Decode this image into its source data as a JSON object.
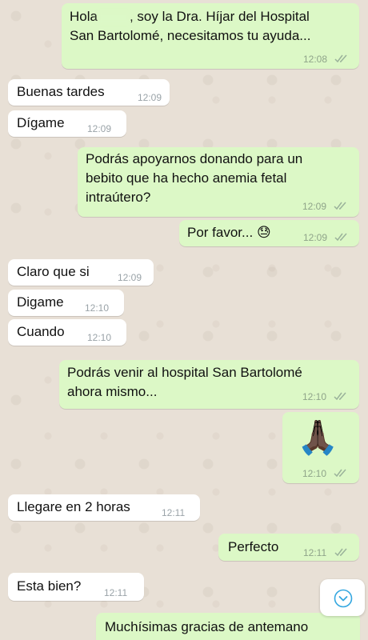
{
  "messages": [
    {
      "direction": "out",
      "text_parts": [
        "Hola",
        ", soy la Dra. Híjar del Hospital",
        "San Bartolomé, necesitamos tu ayuda..."
      ],
      "time": "12:08"
    },
    {
      "direction": "in",
      "text": "Buenas tardes",
      "time": "12:09"
    },
    {
      "direction": "in",
      "text": "Dígame",
      "time": "12:09"
    },
    {
      "direction": "out",
      "text_lines": [
        "Podrás apoyarnos donando para un",
        "bebito que ha hecho anemia fetal",
        "intraútero?"
      ],
      "time": "12:09"
    },
    {
      "direction": "out",
      "text": "Por favor...",
      "emoji": "😓",
      "time": "12:09"
    },
    {
      "direction": "in",
      "text": "Claro que si",
      "time": "12:09"
    },
    {
      "direction": "in",
      "text": "Digame",
      "time": "12:10"
    },
    {
      "direction": "in",
      "text": "Cuando",
      "time": "12:10"
    },
    {
      "direction": "out",
      "text_lines": [
        "Podrás venir al hospital San Bartolomé",
        "ahora mismo..."
      ],
      "time": "12:10"
    },
    {
      "direction": "out",
      "emoji": "🙏🏿",
      "time": "12:10"
    },
    {
      "direction": "in",
      "text": "Llegare en 2 horas",
      "time": "12:11"
    },
    {
      "direction": "out",
      "text": "Perfecto",
      "time": "12:11"
    },
    {
      "direction": "in",
      "text": "Esta bien?",
      "time": "12:11"
    },
    {
      "direction": "out",
      "text": "Muchísimas gracias de antemano",
      "time": ""
    }
  ],
  "scroll_button": {
    "icon": "chevron-down-icon"
  },
  "colors": {
    "outgoing_bubble": "#dcf8c6",
    "incoming_bubble": "#ffffff",
    "read_ticks": "#9ab29a",
    "accent": "#34a7e0"
  }
}
